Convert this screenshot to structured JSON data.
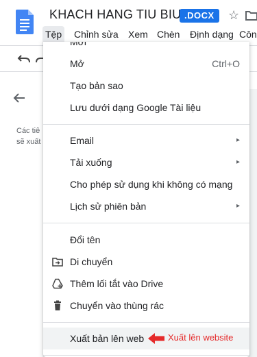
{
  "header": {
    "title": "KHACH HANG TIU BIU",
    "badge": ".DOCX",
    "menus": [
      "Tệp",
      "Chỉnh sửa",
      "Xem",
      "Chèn",
      "Định dạng",
      "Côn"
    ]
  },
  "outline_hint": {
    "line1": "Các tiê",
    "line2": "sẽ xuất"
  },
  "file_menu": {
    "cut_item": "Mới",
    "items": [
      {
        "label": "Mở",
        "shortcut": "Ctrl+O"
      },
      {
        "label": "Tạo bản sao"
      },
      {
        "label": "Lưu dưới dạng Google Tài liệu"
      },
      {
        "label": "Email",
        "submenu": "▸"
      },
      {
        "label": "Tải xuống",
        "submenu": "▸"
      },
      {
        "label": "Cho phép sử dụng khi không có mạng"
      },
      {
        "label": "Lịch sử phiên bản",
        "submenu": "▸"
      },
      {
        "label": "Đổi tên"
      },
      {
        "label": "Di chuyển",
        "icon": "move-folder-icon"
      },
      {
        "label": "Thêm lối tắt vào Drive",
        "icon": "add-shortcut-icon"
      },
      {
        "label": "Chuyển vào thùng rác",
        "icon": "trash-icon"
      },
      {
        "label": "Xuất bản lên web"
      }
    ]
  },
  "annotation": {
    "text": "Xuất lên website",
    "color": "#e52b2b"
  },
  "colors": {
    "accent": "#1a73e8",
    "docs_blue": "#4285f4"
  }
}
